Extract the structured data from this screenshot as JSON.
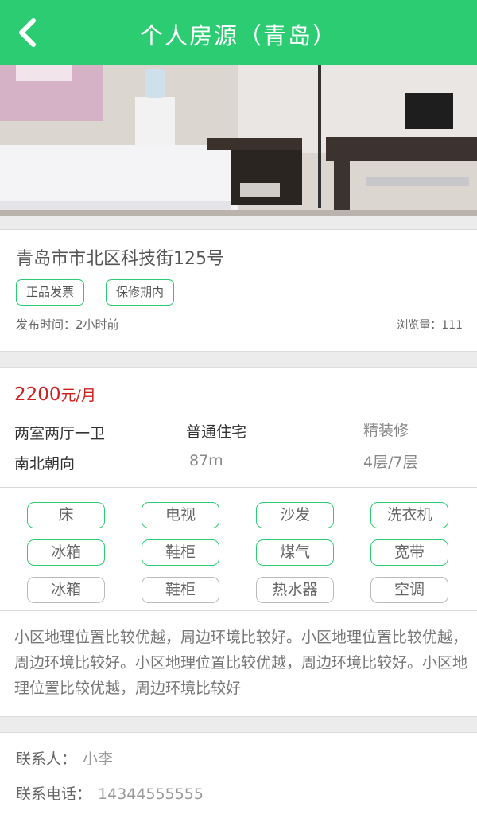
{
  "header": {
    "title": "个人房源（青岛）",
    "back_icon": "chevron-left-icon",
    "color": "#2ccc73"
  },
  "listing": {
    "address": "青岛市市北区科技街125号",
    "tags": [
      "正品发票",
      "保修期内"
    ],
    "publish_label": "发布时间：",
    "publish_value": "2小时前",
    "views_label": "浏览量：",
    "views_value": "111"
  },
  "details": {
    "price": "2200",
    "price_unit": "元/月",
    "price_color": "#cc2020",
    "layout": "两室两厅一卫",
    "housing_type": "普通住宅",
    "decoration": "精装修",
    "orientation": "南北朝向",
    "area": "87m",
    "floor": "4层/7层"
  },
  "amenities": [
    {
      "label": "床",
      "available": true
    },
    {
      "label": "电视",
      "available": true
    },
    {
      "label": "沙发",
      "available": true
    },
    {
      "label": "洗衣机",
      "available": true
    },
    {
      "label": "冰箱",
      "available": true
    },
    {
      "label": "鞋柜",
      "available": true
    },
    {
      "label": "煤气",
      "available": true
    },
    {
      "label": "宽带",
      "available": true
    },
    {
      "label": "冰箱",
      "available": false
    },
    {
      "label": "鞋柜",
      "available": false
    },
    {
      "label": "热水器",
      "available": false
    },
    {
      "label": "空调",
      "available": false
    }
  ],
  "description": "小区地理位置比较优越，周边环境比较好。小区地理位置比较优越，周边环境比较好。小区地理位置比较优越，周边环境比较好。小区地理位置比较优越，周边环境比较好",
  "contact": {
    "name_label": "联系人：",
    "name": "小李",
    "phone_label": "联系电话：",
    "phone": "14344555555"
  }
}
